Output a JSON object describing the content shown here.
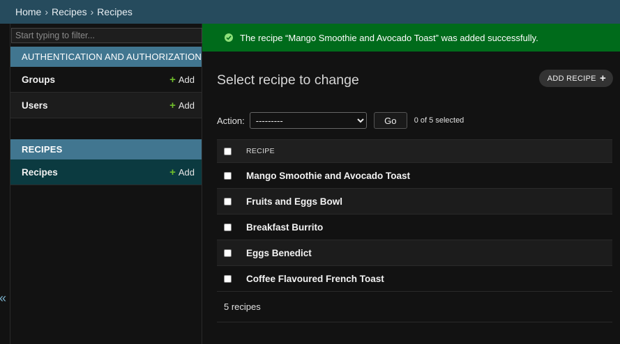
{
  "breadcrumb": {
    "home": "Home",
    "sep": "›",
    "app": "Recipes",
    "current": "Recipes"
  },
  "sidebar": {
    "toggle_glyph": "«",
    "filter_placeholder": "Start typing to filter...",
    "modules": [
      {
        "caption": "AUTHENTICATION AND AUTHORIZATION",
        "models": [
          {
            "name": "Groups",
            "add": "Add"
          },
          {
            "name": "Users",
            "add": "Add"
          }
        ]
      },
      {
        "caption": "RECIPES",
        "models": [
          {
            "name": "Recipes",
            "add": "Add"
          }
        ]
      }
    ]
  },
  "message": "The recipe “Mango Smoothie and Avocado Toast” was added successfully.",
  "main": {
    "title": "Select recipe to change",
    "add_button": "ADD RECIPE",
    "action_label": "Action:",
    "action_selected": "---------",
    "go": "Go",
    "counter": "0 of 5 selected",
    "column": "RECIPE",
    "rows": [
      "Mango Smoothie and Avocado Toast",
      "Fruits and Eggs Bowl",
      "Breakfast Burrito",
      "Eggs Benedict",
      "Coffee Flavoured French Toast"
    ],
    "paginator": "5 recipes"
  },
  "colors": {
    "header": "#264b5d",
    "module": "#417690",
    "success": "#006b1b",
    "current_row": "#0b3a40",
    "add_plus": "#70bf2b"
  }
}
